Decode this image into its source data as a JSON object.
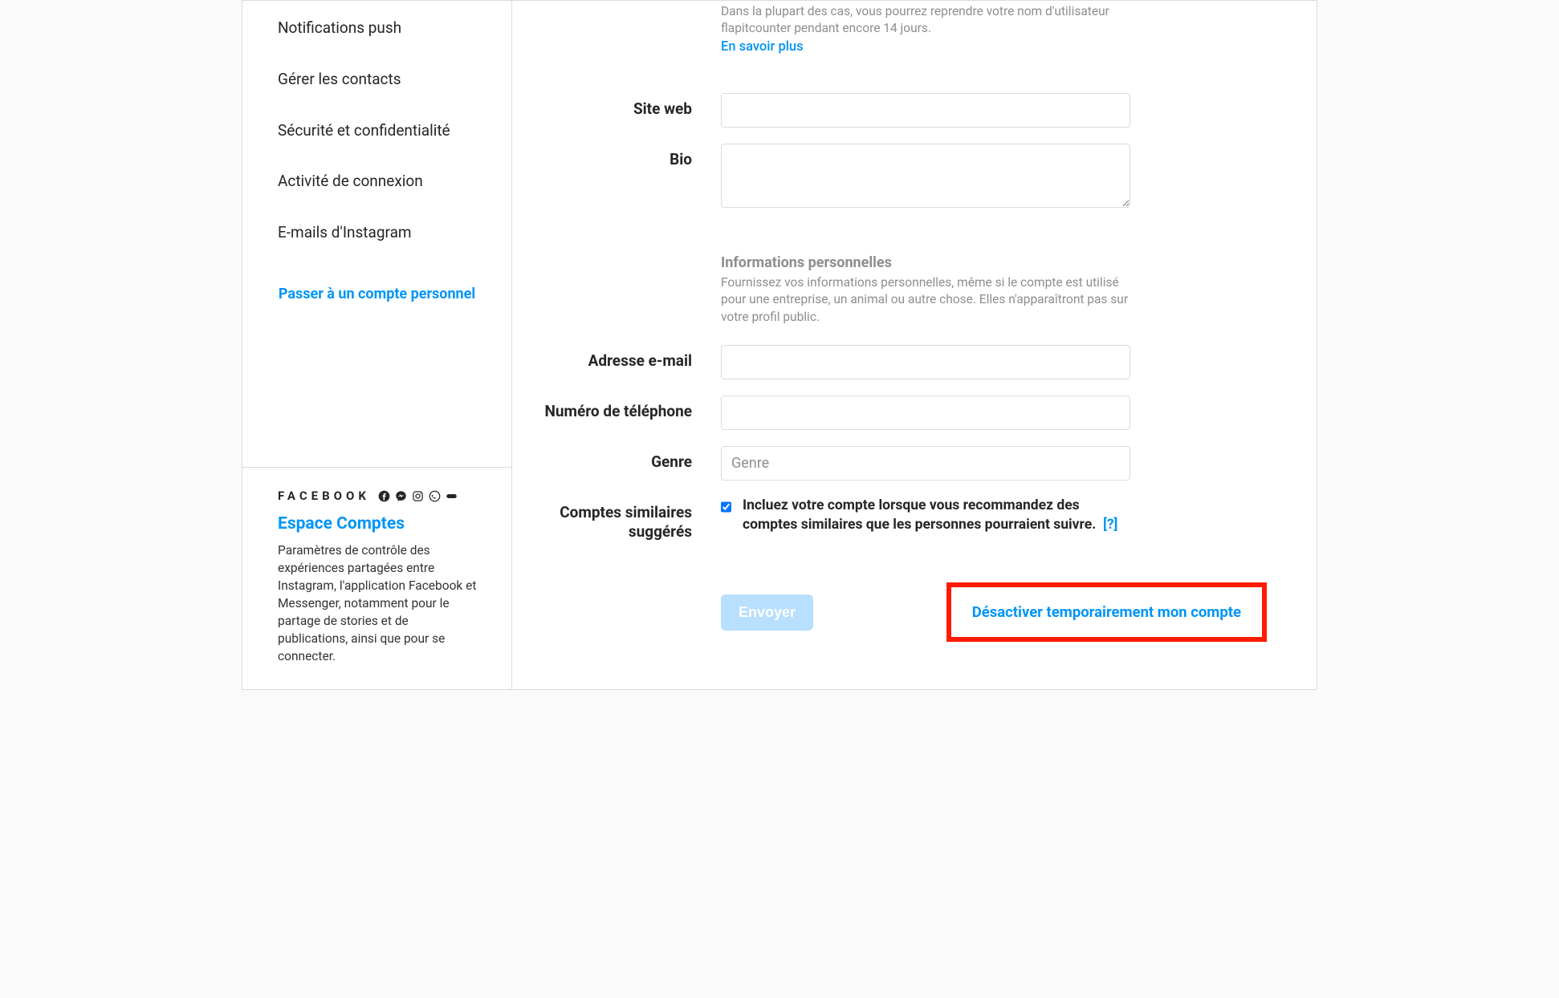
{
  "sidebar": {
    "items": [
      {
        "label": "Notifications push"
      },
      {
        "label": "Gérer les contacts"
      },
      {
        "label": "Sécurité et confidentialité"
      },
      {
        "label": "Activité de connexion"
      },
      {
        "label": "E-mails d'Instagram"
      }
    ],
    "switch_link": "Passer à un compte personnel",
    "footer": {
      "brand": "FACEBOOK",
      "espace_link": "Espace Comptes",
      "desc": "Paramètres de contrôle des expériences partagées entre Instagram, l'application Facebook et Messenger, notamment pour le partage de stories et de publications, ainsi que pour se connecter."
    }
  },
  "form": {
    "username_note": "Dans la plupart des cas, vous pourrez reprendre votre nom d'utilisateur flapitcounter pendant encore 14 jours.",
    "learn_more": "En savoir plus",
    "labels": {
      "site_web": "Site web",
      "bio": "Bio",
      "adresse_email": "Adresse e-mail",
      "numero_tel": "Numéro de téléphone",
      "genre": "Genre",
      "comptes_similaires": "Comptes similaires suggérés"
    },
    "values": {
      "site_web": "",
      "bio": "",
      "adresse_email": "",
      "numero_tel": "",
      "genre": ""
    },
    "placeholders": {
      "genre": "Genre"
    },
    "personal_info": {
      "heading": "Informations personnelles",
      "desc": "Fournissez vos informations personnelles, même si le compte est utilisé pour une entreprise, un animal ou autre chose. Elles n'apparaîtront pas sur votre profil public."
    },
    "similar_accounts": {
      "checked": true,
      "text": "Incluez votre compte lorsque vous recommandez des comptes similaires que les personnes pourraient suivre.",
      "help": "[?]"
    },
    "submit_label": "Envoyer",
    "deactivate_label": "Désactiver temporairement mon compte"
  },
  "colors": {
    "accent": "#0095f6",
    "highlight_border": "#ff1a00",
    "muted": "#8e8e8e"
  }
}
